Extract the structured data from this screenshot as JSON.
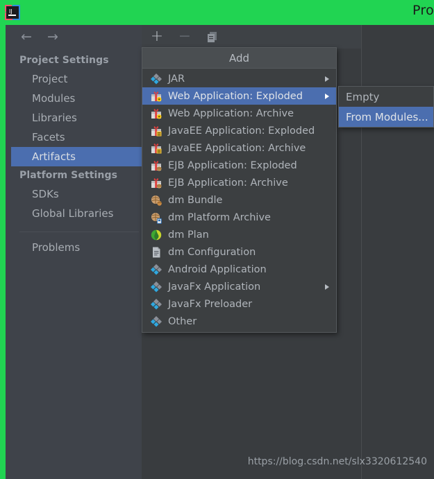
{
  "window": {
    "title": "Pro",
    "logo_icon": "intellij-idea-logo",
    "titlebar_color": "#21d452"
  },
  "nav": {
    "back_icon": "arrow-left-icon",
    "forward_icon": "arrow-right-icon"
  },
  "sidebar": {
    "groups": [
      {
        "header": "Project Settings",
        "items": [
          {
            "label": "Project",
            "selected": false
          },
          {
            "label": "Modules",
            "selected": false
          },
          {
            "label": "Libraries",
            "selected": false
          },
          {
            "label": "Facets",
            "selected": false
          },
          {
            "label": "Artifacts",
            "selected": true
          }
        ]
      },
      {
        "header": "Platform Settings",
        "items": [
          {
            "label": "SDKs",
            "selected": false
          },
          {
            "label": "Global Libraries",
            "selected": false
          }
        ]
      }
    ],
    "problems_label": "Problems",
    "selected_color": "#4b6eaf"
  },
  "toolbar": {
    "add_icon": "plus-icon",
    "remove_icon": "minus-icon",
    "copy_icon": "copy-icon"
  },
  "menu": {
    "title": "Add",
    "items": [
      {
        "label": "JAR",
        "icon": "jar-diamond-icon",
        "has_submenu": true,
        "selected": false
      },
      {
        "label": "Web Application: Exploded",
        "icon": "gift-web-icon",
        "has_submenu": true,
        "selected": true
      },
      {
        "label": "Web Application: Archive",
        "icon": "gift-web-icon",
        "has_submenu": false,
        "selected": false
      },
      {
        "label": "JavaEE Application: Exploded",
        "icon": "gift-javaee-icon",
        "has_submenu": false,
        "selected": false
      },
      {
        "label": "JavaEE Application: Archive",
        "icon": "gift-javaee-icon",
        "has_submenu": false,
        "selected": false
      },
      {
        "label": "EJB Application: Exploded",
        "icon": "gift-ejb-icon",
        "has_submenu": false,
        "selected": false
      },
      {
        "label": "EJB Application: Archive",
        "icon": "gift-ejb-icon",
        "has_submenu": false,
        "selected": false
      },
      {
        "label": "dm Bundle",
        "icon": "dm-bundle-icon",
        "has_submenu": false,
        "selected": false
      },
      {
        "label": "dm Platform Archive",
        "icon": "dm-platform-icon",
        "has_submenu": false,
        "selected": false
      },
      {
        "label": "dm Plan",
        "icon": "dm-plan-globe-icon",
        "has_submenu": false,
        "selected": false
      },
      {
        "label": "dm Configuration",
        "icon": "dm-configuration-icon",
        "has_submenu": false,
        "selected": false
      },
      {
        "label": "Android Application",
        "icon": "jar-diamond-icon",
        "has_submenu": false,
        "selected": false
      },
      {
        "label": "JavaFx Application",
        "icon": "jar-diamond-icon",
        "has_submenu": true,
        "selected": false
      },
      {
        "label": "JavaFx Preloader",
        "icon": "jar-diamond-icon",
        "has_submenu": false,
        "selected": false
      },
      {
        "label": "Other",
        "icon": "jar-diamond-icon",
        "has_submenu": false,
        "selected": false
      }
    ]
  },
  "submenu": {
    "items": [
      {
        "label": "Empty",
        "selected": false
      },
      {
        "label": "From Modules...",
        "selected": true
      }
    ]
  },
  "watermark": {
    "text": "https://blog.csdn.net/slx3320612540"
  }
}
